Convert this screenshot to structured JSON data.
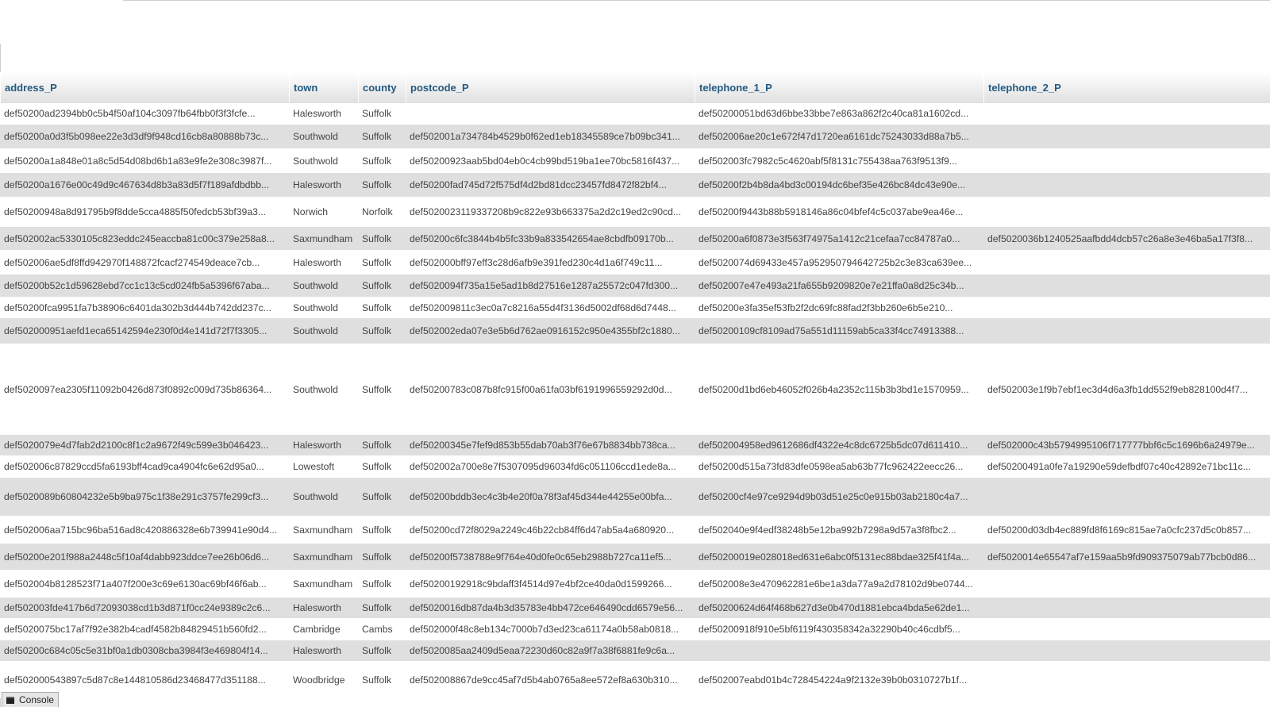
{
  "columns": {
    "address": "address_P",
    "town": "town",
    "county": "county",
    "postcode": "postcode_P",
    "tel1": "telephone_1_P",
    "tel2": "telephone_2_P"
  },
  "rows": [
    {
      "address": "def50200ad2394bb0c5b4f50af104c3097fb64fbb0f3f3fcfe...",
      "town": "Halesworth",
      "county": "Suffolk",
      "postcode": "",
      "tel1": "def50200051bd63d6bbe33bbe7e863a862f2c40ca81a1602cd...",
      "tel2": ""
    },
    {
      "address": "def50200a0d3f5b098ee22e3d3df9f948cd16cb8a80888b73c...",
      "town": "Southwold",
      "county": "Suffolk",
      "postcode": "def502001a734784b4529b0f62ed1eb18345589ce7b09bc341...",
      "tel1": "def502006ae20c1e672f47d1720ea6161dc75243033d88a7b5...",
      "tel2": ""
    },
    {
      "address": "def50200a1a848e01a8c5d54d08bd6b1a83e9fe2e308c3987f...",
      "town": "Southwold",
      "county": "Suffolk",
      "postcode": "def50200923aab5bd04eb0c4cb99bd519ba1ee70bc5816f437...",
      "tel1": "def502003fc7982c5c4620abf5f8131c755438aa763f9513f9...",
      "tel2": ""
    },
    {
      "address": "def50200a1676e00c49d9c467634d8b3a83d5f7f189afdbdbb...",
      "town": "Halesworth",
      "county": "Suffolk",
      "postcode": "def50200fad745d72f575df4d2bd81dcc23457fd8472f82bf4...",
      "tel1": "def50200f2b4b8da4bd3c00194dc6bef35e426bc84dc43e90e...",
      "tel2": ""
    },
    {
      "address": "def50200948a8d91795b9f8dde5cca4885f50fedcb53bf39a3...",
      "town": "Norwich",
      "county": "Norfolk",
      "postcode": "def5020023119337208b9c822e93b663375a2d2c19ed2c90cd...",
      "tel1": "def50200f9443b88b5918146a86c04bfef4c5c037abe9ea46e...",
      "tel2": ""
    },
    {
      "address": "def502002ac5330105c823eddc245eaccba81c00c379e258a8...",
      "town": "Saxmundham",
      "county": "Suffolk",
      "postcode": "def50200c6fc3844b4b5fc33b9a833542654ae8cbdfb09170b...",
      "tel1": "def50200a6f0873e3f563f74975a1412c21cefaa7cc84787a0...",
      "tel2": "def5020036b1240525aafbdd4dcb57c26a8e3e46ba5a17f3f8..."
    },
    {
      "address": "def502006ae5df8ffd942970f148872fcacf274549deace7cb...",
      "town": "Halesworth",
      "county": "Suffolk",
      "postcode": "def502000bff97eff3c28d6afb9e391fed230c4d1a6f749c11...",
      "tel1": "def5020074d69433e457a952950794642725b2c3e83ca639ee...",
      "tel2": ""
    },
    {
      "address": "def50200b52c1d59628ebd7cc1c13c5cd024fb5a5396f67aba...",
      "town": "Southwold",
      "county": "Suffolk",
      "postcode": "def5020094f735a15e5ad1b8d27516e1287a25572c047fd300...",
      "tel1": "def502007e47e493a21fa655b9209820e7e21ffa0a8d25c34b...",
      "tel2": ""
    },
    {
      "address": "def50200fca9951fa7b38906c6401da302b3d444b742dd237c...",
      "town": "Southwold",
      "county": "Suffolk",
      "postcode": "def502009811c3ec0a7c8216a55d4f3136d5002df68d6d7448...",
      "tel1": "def50200e3fa35ef53fb2f2dc69fc88fad2f3bb260e6b5e210...",
      "tel2": ""
    },
    {
      "address": "def502000951aefd1eca65142594e230f0d4e141d72f7f3305...",
      "town": "Southwold",
      "county": "Suffolk",
      "postcode": "def502002eda07e3e5b6d762ae0916152c950e4355bf2c1880...",
      "tel1": "def50200109cf8109ad75a551d11159ab5ca33f4cc74913388...",
      "tel2": ""
    },
    {
      "address": "def5020097ea2305f11092b0426d873f0892c009d735b86364...",
      "town": "Southwold",
      "county": "Suffolk",
      "postcode": "def50200783c087b8fc915f00a61fa03bf6191996559292d0d...",
      "tel1": "def50200d1bd6eb46052f026b4a2352c115b3b3bd1e1570959...",
      "tel2": "def502003e1f9b7ebf1ec3d4d6a3fb1dd552f9eb828100d4f7..."
    },
    {
      "address": "def5020079e4d7fab2d2100c8f1c2a9672f49c599e3b046423...",
      "town": "Halesworth",
      "county": "Suffolk",
      "postcode": "def50200345e7fef9d853b55dab70ab3f76e67b8834bb738ca...",
      "tel1": "def502004958ed9612686df4322e4c8dc6725b5dc07d611410...",
      "tel2": "def502000c43b5794995106f717777bbf6c5c1696b6a24979e..."
    },
    {
      "address": "def502006c87829ccd5fa6193bff4cad9ca4904fc6e62d95a0...",
      "town": "Lowestoft",
      "county": "Suffolk",
      "postcode": "def502002a700e8e7f5307095d96034fd6c051106ccd1ede8a...",
      "tel1": "def50200d515a73fd83dfe0598ea5ab63b77fc962422eecc26...",
      "tel2": "def50200491a0fe7a19290e59defbdf07c40c42892e71bc11c..."
    },
    {
      "address": "def5020089b60804232e5b9ba975c1f38e291c3757fe299cf3...",
      "town": "Southwold",
      "county": "Suffolk",
      "postcode": "def50200bddb3ec4c3b4e20f0a78f3af45d344e44255e00bfa...",
      "tel1": "def50200cf4e97ce9294d9b03d51e25c0e915b03ab2180c4a7...",
      "tel2": ""
    },
    {
      "address": "def502006aa715bc96ba516ad8c420886328e6b739941e90d4...",
      "town": "Saxmundham",
      "county": "Suffolk",
      "postcode": "def50200cd72f8029a2249c46b22cb84ff6d47ab5a4a680920...",
      "tel1": "def502040e9f4edf38248b5e12ba992b7298a9d57a3f8fbc2...",
      "tel2": "def50200d03db4ec889fd8f6169c815ae7a0cfc237d5c0b857..."
    },
    {
      "address": "def50200e201f988a2448c5f10af4dabb923ddce7ee26b06d6...",
      "town": "Saxmundham",
      "county": "Suffolk",
      "postcode": "def50200f5738788e9f764e40d0fe0c65eb2988b727ca11ef5...",
      "tel1": "def50200019e028018ed631e6abc0f5131ec88bdae325f41f4a...",
      "tel2": "def5020014e65547af7e159aa5b9fd909375079ab77bcb0d86..."
    },
    {
      "address": "def502004b8128523f71a407f200e3c69e6130ac69bf46f6ab...",
      "town": "Saxmundham",
      "county": "Suffolk",
      "postcode": "def50200192918c9bdaff3f4514d97e4bf2ce40da0d1599266...",
      "tel1": "def502008e3e470962281e6be1a3da77a9a2d78102d9be0744...",
      "tel2": ""
    },
    {
      "address": "def502003fde417b6d72093038cd1b3d871f0cc24e9389c2c6...",
      "town": "Halesworth",
      "county": "Suffolk",
      "postcode": "def5020016db87da4b3d35783e4bb472ce646490cdd6579e56...",
      "tel1": "def50200624d64f468b627d3e0b470d1881ebca4bda5e62de1...",
      "tel2": ""
    },
    {
      "address": "def5020075bc17af7f92e382b4cadf4582b84829451b560fd2...",
      "town": "Cambridge",
      "county": "Cambs",
      "postcode": "def502000f48c8eb134c7000b7d3ed23ca61174a0b58ab0818...",
      "tel1": "def50200918f910e5bf6119f430358342a32290b40c46cdbf5...",
      "tel2": ""
    },
    {
      "address": "def50200c684c05c5e31bf0a1db0308cba3984f3e469804f14...",
      "town": "Halesworth",
      "county": "Suffolk",
      "postcode": "def5020085aa2409d5eaa72230d60c82a9f7a38f6881fe9c6a...",
      "tel1": "",
      "tel2": ""
    },
    {
      "address": "def502000543897c5d87c8e144810586d23468477d351188...",
      "town": "Woodbridge",
      "county": "Suffolk",
      "postcode": "def502008867de9cc45af7d5b4ab0765a8ee572ef8a630b310...",
      "tel1": "def502007eabd01b4c728454224a9f2132e39b0b0310727b1f...",
      "tel2": ""
    }
  ],
  "console": {
    "label": "Console"
  }
}
